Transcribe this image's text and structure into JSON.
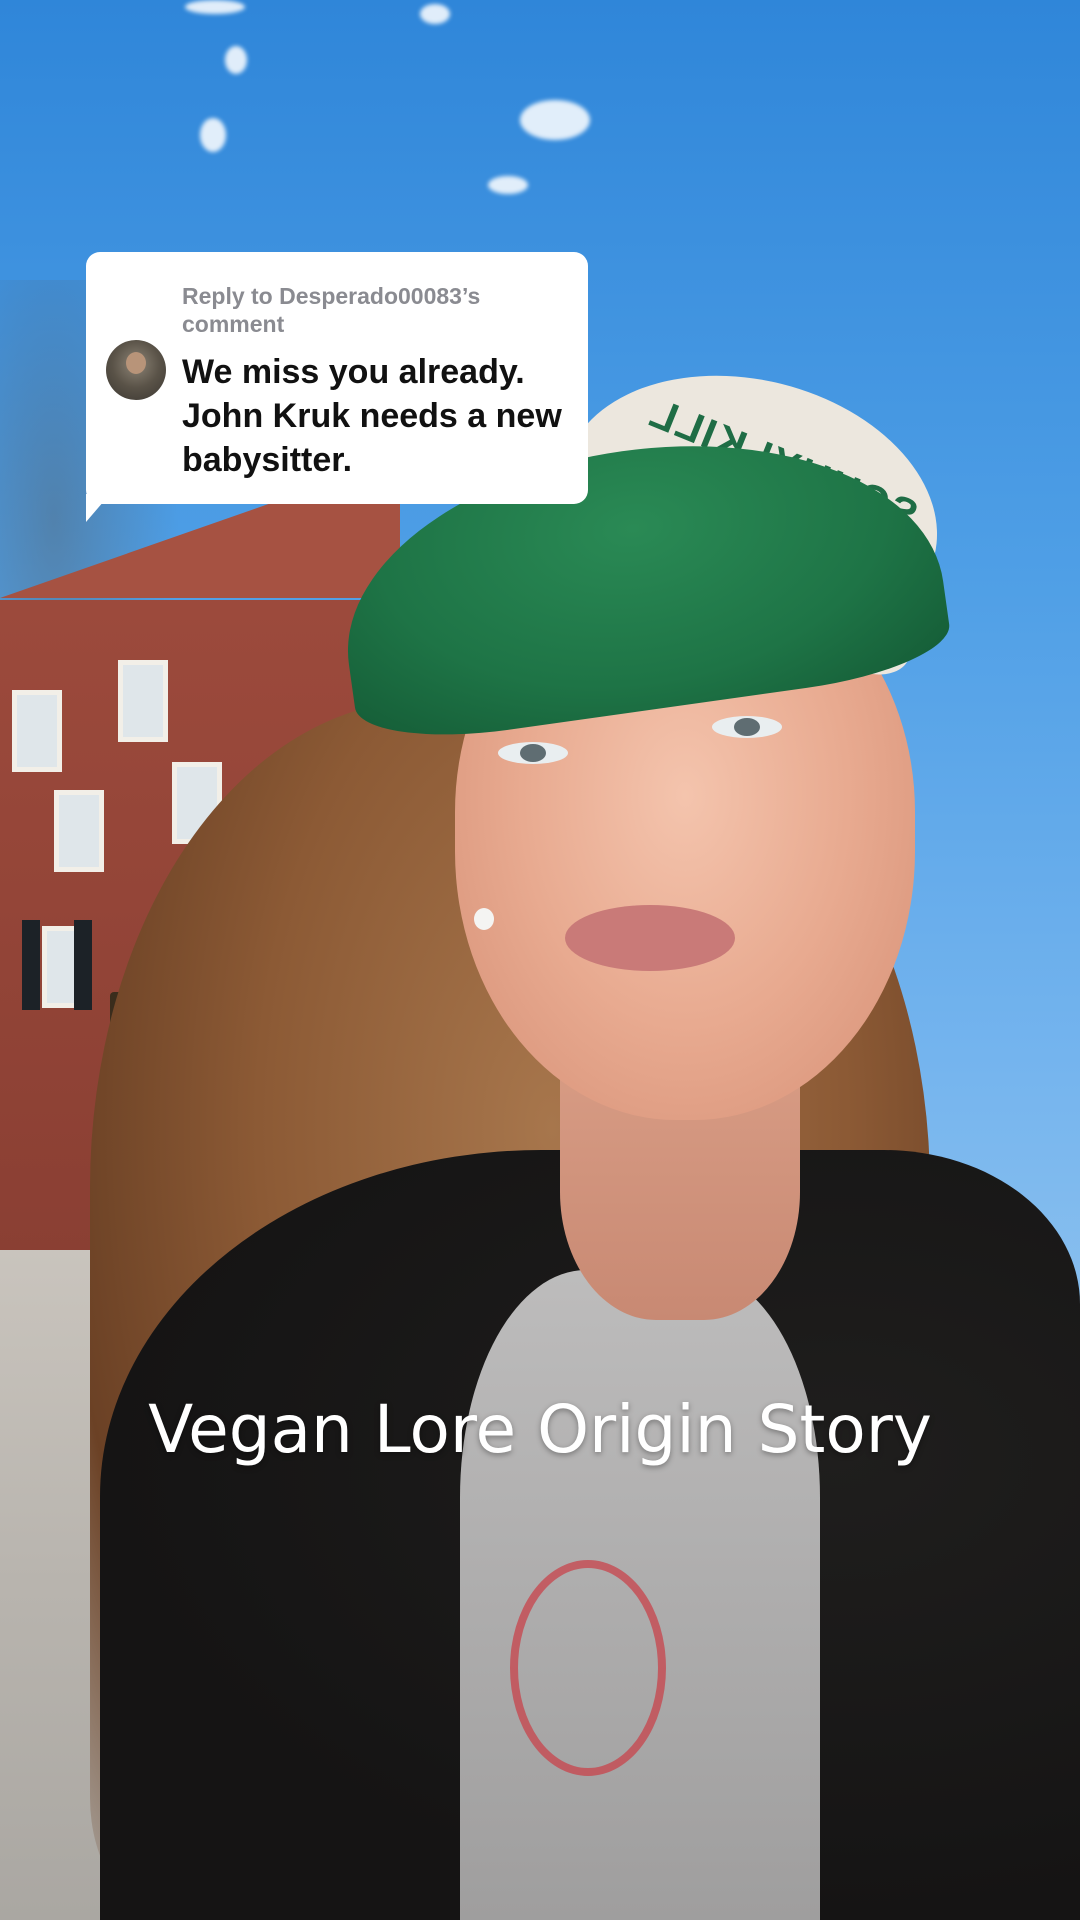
{
  "video": {
    "scene_description_hidden": "",
    "cap_text": "SCHUYLKILL"
  },
  "reply_sticker": {
    "prefix": "Reply to",
    "username": "Desperado00083",
    "suffix": "’s comment",
    "comment_text": "We miss you already. John Kruk needs a new babysitter."
  },
  "caption": {
    "text": "Vegan Lore Origin Story"
  },
  "colors": {
    "sticker_bg": "#ffffff",
    "meta_text": "#8a8b91",
    "comment_text": "#111111",
    "caption_text": "#ffffff"
  }
}
